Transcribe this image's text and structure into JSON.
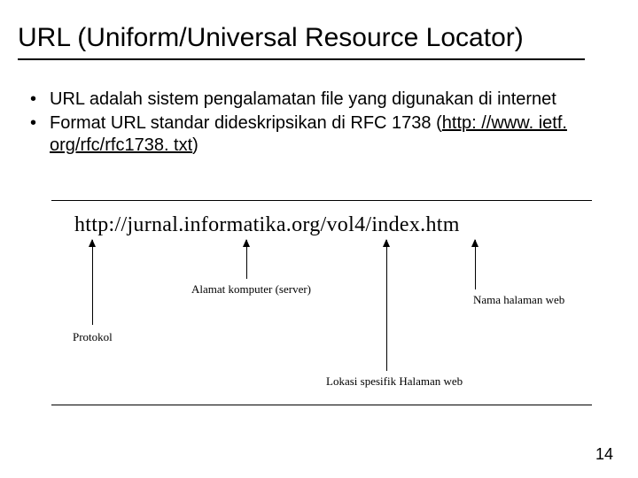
{
  "title": "URL (Uniform/Universal Resource Locator)",
  "bullets": {
    "b1": "URL adalah sistem pengalamatan file yang digunakan di internet",
    "b2_pre": "Format URL standar dideskripsikan di RFC 1738 (",
    "b2_link": "http: //www. ietf. org/rfc/rfc1738. txt",
    "b2_post": ")"
  },
  "diagram": {
    "url_text": "http://jurnal.informatika.org/vol4/index.htm",
    "labels": {
      "protocol": "Protokol",
      "server": "Alamat komputer (server)",
      "path": "Lokasi spesifik Halaman web",
      "page": "Nama halaman web"
    }
  },
  "page_number": "14"
}
